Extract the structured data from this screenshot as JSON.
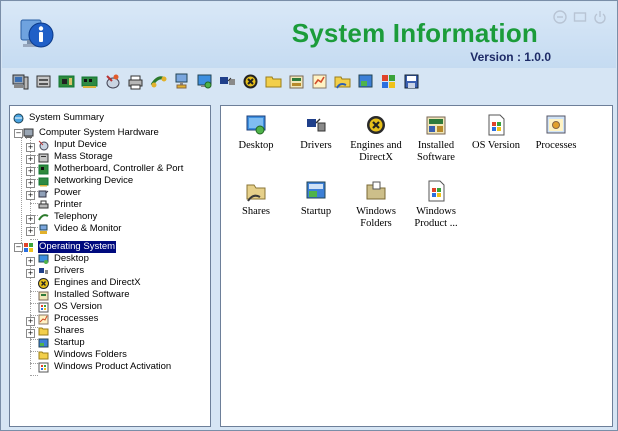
{
  "header": {
    "title": "System Information",
    "version": "Version : 1.0.0",
    "logo_icon": "info-globe-icon",
    "window_controls": [
      "minimize-icon",
      "restore-icon",
      "power-icon"
    ]
  },
  "toolbar": {
    "buttons": [
      "computer-hardware-icon",
      "mass-storage-icon",
      "motherboard-icon",
      "networking-icon",
      "input-device-icon",
      "printer-icon",
      "telephony-icon",
      "video-monitor-icon",
      "desktop-icon",
      "drivers-icon",
      "engines-directx-icon",
      "folder-icon",
      "installed-software-icon",
      "processes-icon",
      "shares-icon",
      "startup-icon",
      "windows-product-icon",
      "save-icon"
    ]
  },
  "tree": {
    "items": [
      {
        "label": "System Summary",
        "icon": "system-summary-icon"
      },
      {
        "label": "Computer System Hardware",
        "icon": "hardware-icon"
      },
      {
        "label": "Input Device",
        "icon": "input-device-icon"
      },
      {
        "label": "Mass Storage",
        "icon": "mass-storage-icon"
      },
      {
        "label": "Motherboard, Controller & Port",
        "icon": "motherboard-icon"
      },
      {
        "label": "Networking Device",
        "icon": "networking-icon"
      },
      {
        "label": "Power",
        "icon": "power-icon"
      },
      {
        "label": "Printer",
        "icon": "printer-icon"
      },
      {
        "label": "Telephony",
        "icon": "telephony-icon"
      },
      {
        "label": "Video & Monitor",
        "icon": "video-monitor-icon"
      },
      {
        "label": "Operating System",
        "icon": "operating-system-icon",
        "selected": true
      },
      {
        "label": "Desktop",
        "icon": "desktop-icon"
      },
      {
        "label": "Drivers",
        "icon": "drivers-icon"
      },
      {
        "label": "Engines and DirectX",
        "icon": "directx-icon"
      },
      {
        "label": "Installed Software",
        "icon": "installed-software-icon"
      },
      {
        "label": "OS Version",
        "icon": "os-version-icon"
      },
      {
        "label": "Processes",
        "icon": "processes-icon"
      },
      {
        "label": "Shares",
        "icon": "shares-icon"
      },
      {
        "label": "Startup",
        "icon": "startup-icon"
      },
      {
        "label": "Windows Folders",
        "icon": "folder-icon"
      },
      {
        "label": "Windows Product Activation",
        "icon": "product-activation-icon"
      }
    ]
  },
  "icons": [
    {
      "label": "Desktop",
      "icon": "desktop-icon"
    },
    {
      "label": "Drivers",
      "icon": "drivers-icon"
    },
    {
      "label": "Engines and DirectX",
      "icon": "directx-icon"
    },
    {
      "label": "Installed Software",
      "icon": "installed-software-icon"
    },
    {
      "label": "OS Version",
      "icon": "os-version-icon"
    },
    {
      "label": "Processes",
      "icon": "processes-icon"
    },
    {
      "label": "Shares",
      "icon": "shares-icon"
    },
    {
      "label": "Startup",
      "icon": "startup-icon"
    },
    {
      "label": "Windows Folders",
      "icon": "folder-icon"
    },
    {
      "label": "Windows Product ...",
      "icon": "product-activation-icon"
    }
  ],
  "colors": {
    "title": "#1b9c3a",
    "version": "#1d2a66",
    "selection": "#000a7e",
    "background": "#d6e5f4"
  }
}
